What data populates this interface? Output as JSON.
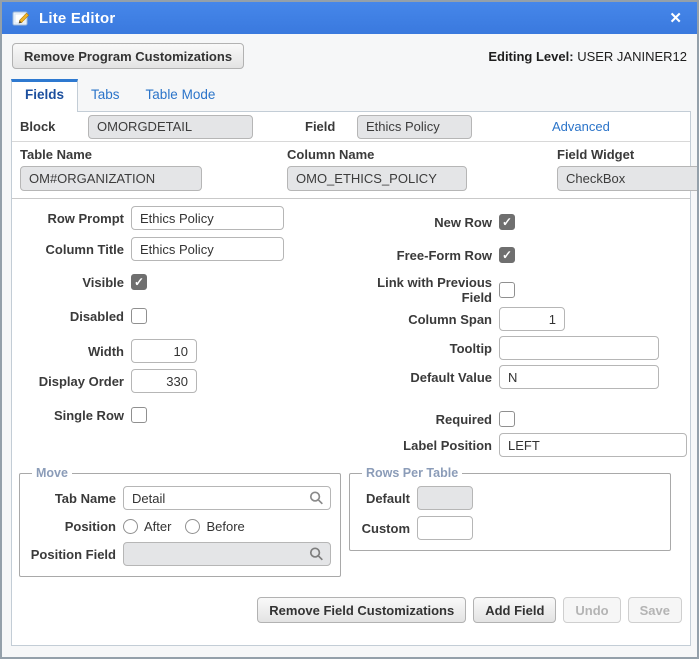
{
  "window": {
    "title": "Lite Editor"
  },
  "icons": {
    "close": "✕"
  },
  "toolbar": {
    "remove_program_button": "Remove Program Customizations",
    "editing_level_label": "Editing Level:",
    "editing_level_value": "USER JANINER12"
  },
  "tabs": {
    "fields": "Fields",
    "tabs": "Tabs",
    "table_mode": "Table Mode"
  },
  "header": {
    "block_label": "Block",
    "block_value": "OMORGDETAIL",
    "field_label": "Field",
    "field_value": "Ethics Policy",
    "advanced_link": "Advanced",
    "table_name_label": "Table Name",
    "table_name_value": "OM#ORGANIZATION",
    "column_name_label": "Column Name",
    "column_name_value": "OMO_ETHICS_POLICY",
    "field_widget_label": "Field Widget",
    "field_widget_value": "CheckBox"
  },
  "form": {
    "row_prompt_label": "Row Prompt",
    "row_prompt_value": "Ethics Policy",
    "column_title_label": "Column Title",
    "column_title_value": "Ethics Policy",
    "visible_label": "Visible",
    "visible_checked": true,
    "disabled_label": "Disabled",
    "disabled_checked": false,
    "width_label": "Width",
    "width_value": "10",
    "display_order_label": "Display Order",
    "display_order_value": "330",
    "single_row_label": "Single Row",
    "single_row_checked": false,
    "new_row_label": "New Row",
    "new_row_checked": true,
    "free_form_row_label": "Free-Form Row",
    "free_form_row_checked": true,
    "link_previous_label": "Link with Previous Field",
    "link_previous_checked": false,
    "column_span_label": "Column Span",
    "column_span_value": "1",
    "tooltip_label": "Tooltip",
    "tooltip_value": "",
    "default_value_label": "Default Value",
    "default_value_value": "N",
    "required_label": "Required",
    "required_checked": false,
    "label_position_label": "Label Position",
    "label_position_value": "LEFT"
  },
  "move_group": {
    "legend": "Move",
    "tab_name_label": "Tab Name",
    "tab_name_value": "Detail",
    "position_label": "Position",
    "after_label": "After",
    "before_label": "Before",
    "position_field_label": "Position Field",
    "position_field_value": ""
  },
  "rows_group": {
    "legend": "Rows Per Table",
    "default_label": "Default",
    "default_value": "",
    "custom_label": "Custom",
    "custom_value": ""
  },
  "footer": {
    "remove_field_button": "Remove Field Customizations",
    "add_field_button": "Add Field",
    "undo_button": "Undo",
    "save_button": "Save"
  },
  "colors": {
    "titlebar_blue": "#3d7ee4",
    "link_blue": "#2b74c9",
    "active_tab_text": "#1c4f9e",
    "legend_slate": "#8b9cb8",
    "checkbox_checked": "#6f6f6f"
  }
}
